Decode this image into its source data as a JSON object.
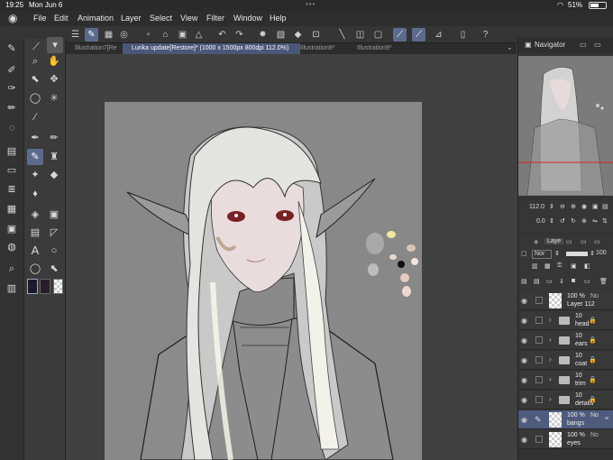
{
  "status": {
    "time": "19:25",
    "date": "Mon Jun 6",
    "battery": "51%"
  },
  "menu": [
    "File",
    "Edit",
    "Animation",
    "Layer",
    "Select",
    "View",
    "Filter",
    "Window",
    "Help"
  ],
  "tabs": [
    {
      "label": "Illustration7[Re",
      "active": false
    },
    {
      "label": "Lurika update[Restore]* (1000 x 1500px 800dpi 112.0%)",
      "active": true
    },
    {
      "label": "Illustration8*",
      "active": false
    },
    {
      "label": "Illustration9*",
      "active": false
    }
  ],
  "navigator": {
    "title": "Navigator",
    "zoom": "112.0",
    "rotation": "0.0"
  },
  "layer_panel": {
    "tab": "Laye",
    "blend": "Nor",
    "opacity": "100"
  },
  "layers": [
    {
      "pct": "100 %",
      "name": "Layer 112",
      "type": "raster",
      "blend": "No"
    },
    {
      "pct": "10",
      "name": "head",
      "type": "folder"
    },
    {
      "pct": "10",
      "name": "ears",
      "type": "folder"
    },
    {
      "pct": "10",
      "name": "coat",
      "type": "folder"
    },
    {
      "pct": "10",
      "name": "trim",
      "type": "folder"
    },
    {
      "pct": "10",
      "name": "details",
      "type": "folder"
    },
    {
      "pct": "100 %",
      "name": "bangs",
      "type": "raster",
      "selected": true,
      "blend": "No"
    },
    {
      "pct": "100 %",
      "name": "eyes",
      "type": "raster",
      "blend": "No"
    }
  ],
  "colors": {
    "accent": "#5c6b8c",
    "tab_active": "#4a5778",
    "layer_selected": "#4e5b7c",
    "canvas": "#888888"
  }
}
